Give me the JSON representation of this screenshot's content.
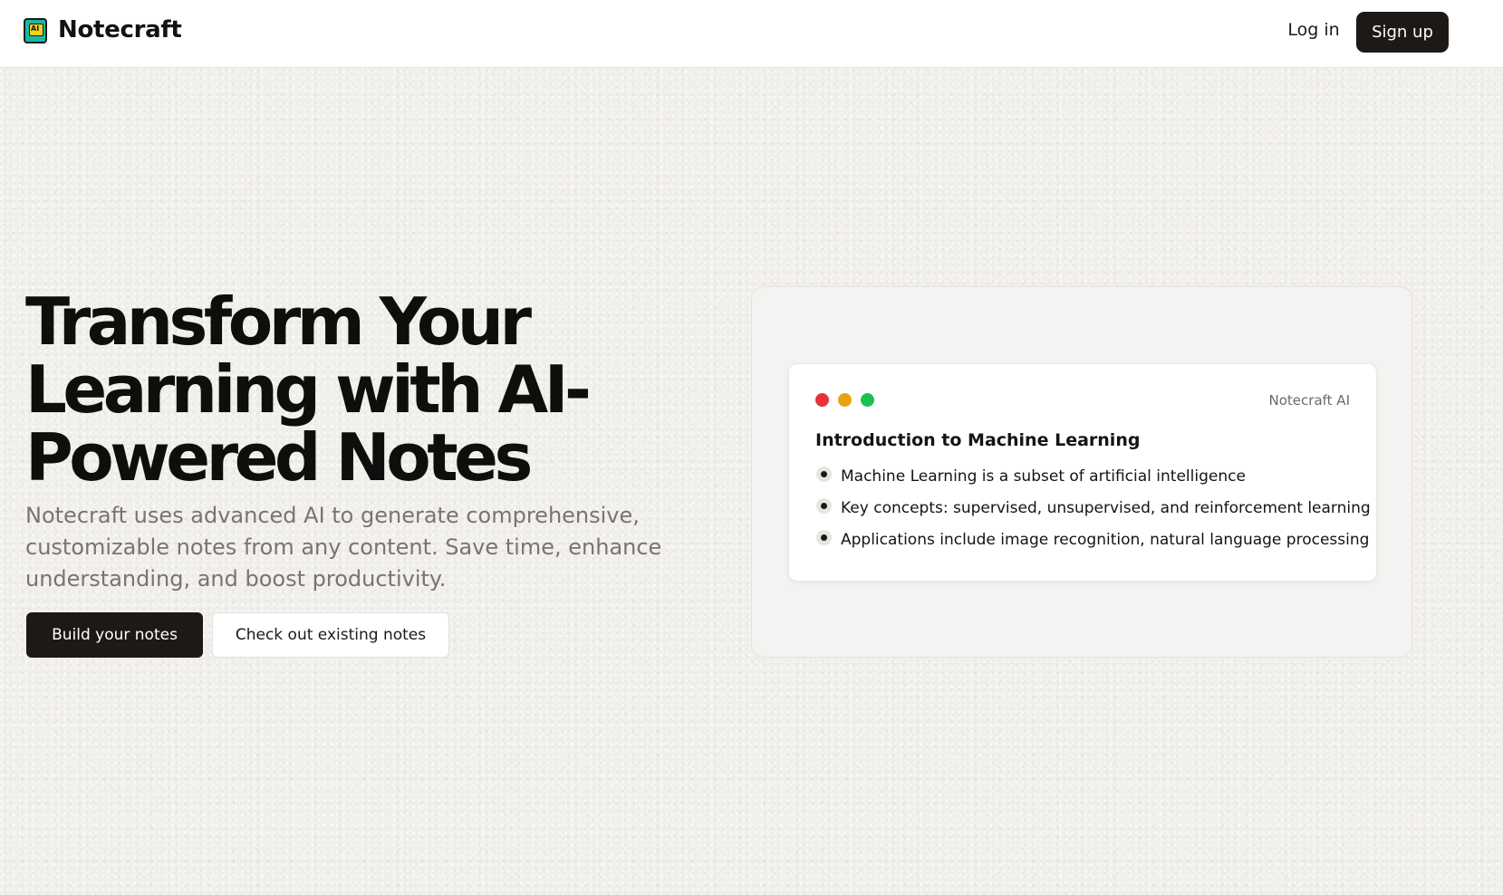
{
  "header": {
    "brand": "Notecraft",
    "logo_icon": "notebook-ai-icon",
    "logo_icon_text": "AI",
    "login_label": "Log in",
    "signup_label": "Sign up"
  },
  "hero": {
    "title": "Transform Your Learning with AI-Powered Notes",
    "subtitle": "Notecraft uses advanced AI to generate comprehensive, customizable notes from any content. Save time, enhance understanding, and boost productivity.",
    "primary_cta": "Build your notes",
    "secondary_cta": "Check out existing notes"
  },
  "preview": {
    "tag": "Notecraft AI",
    "window_dots": [
      "#e8323a",
      "#e9a311",
      "#1ac150"
    ],
    "title": "Introduction to Machine Learning",
    "bullets": [
      "Machine Learning is a subset of artificial intelligence",
      "Key concepts: supervised, unsupervised, and reinforcement learning",
      "Applications include image recognition, natural language processing"
    ]
  },
  "colors": {
    "primary_button": "#1c1917",
    "background": "#f1efeb",
    "subtitle_text": "#7a746d"
  }
}
